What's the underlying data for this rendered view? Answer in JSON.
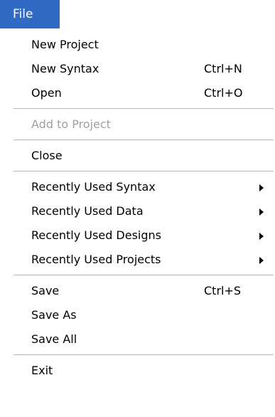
{
  "menubar": {
    "file_label": "File"
  },
  "menu": {
    "new_project": "New Project",
    "new_syntax": "New Syntax",
    "new_syntax_shortcut": "Ctrl+N",
    "open": "Open",
    "open_shortcut": "Ctrl+O",
    "add_to_project": "Add to Project",
    "close": "Close",
    "recent_syntax": "Recently Used Syntax",
    "recent_data": "Recently Used Data",
    "recent_designs": "Recently Used Designs",
    "recent_projects": "Recently Used Projects",
    "save": "Save",
    "save_shortcut": "Ctrl+S",
    "save_as": "Save As",
    "save_all": "Save All",
    "exit": "Exit"
  },
  "colors": {
    "highlight": "#316ac5",
    "disabled_text": "#a0a0a0",
    "separator": "#b4b4b4"
  }
}
